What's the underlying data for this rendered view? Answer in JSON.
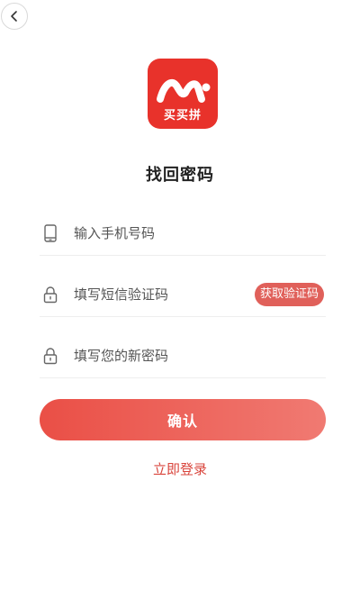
{
  "header": {
    "back_icon": "chevron-left-icon"
  },
  "logo": {
    "text": "买买拼",
    "brand_color": "#e8322b"
  },
  "page": {
    "title": "找回密码"
  },
  "form": {
    "phone": {
      "icon": "phone-icon",
      "placeholder": "输入手机号码",
      "value": ""
    },
    "sms_code": {
      "icon": "lock-icon",
      "placeholder": "填写短信验证码",
      "value": "",
      "get_code_label": "获取验证码"
    },
    "new_password": {
      "icon": "lock-icon",
      "placeholder": "填写您的新密码",
      "value": ""
    }
  },
  "actions": {
    "confirm_label": "确认",
    "login_link": "立即登录",
    "accent_color": "#e8453c"
  }
}
